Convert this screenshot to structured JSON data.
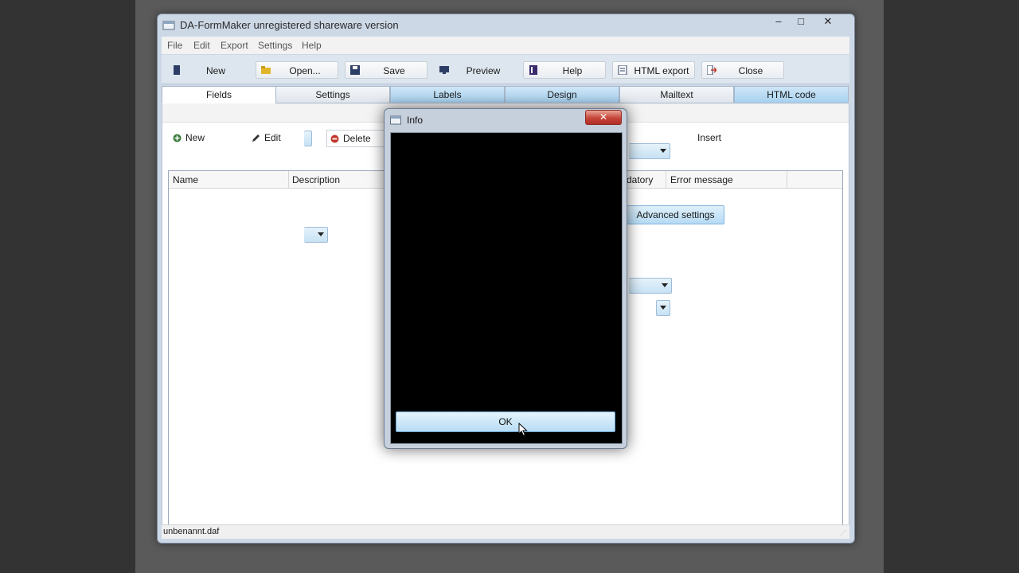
{
  "window": {
    "title": "DA-FormMaker unregistered shareware version",
    "minimize": "–",
    "maximize": "□",
    "close": "✕"
  },
  "menu": [
    "File",
    "Edit",
    "Export",
    "Settings",
    "Help"
  ],
  "toolbar": {
    "new": "New",
    "open": "Open...",
    "save": "Save",
    "preview": "Preview",
    "help": "Help",
    "html_export": "HTML export",
    "close": "Close"
  },
  "tabs": [
    "Fields",
    "Settings",
    "Labels",
    "Design",
    "Mailtext",
    "HTML code"
  ],
  "fields_panel": {
    "new": "New",
    "edit": "Edit",
    "delete": "Delete",
    "insert": "Insert",
    "columns": {
      "name": "Name",
      "description": "Description",
      "mandatory": "datory",
      "error_message": "Error message"
    },
    "advanced_settings": "Advanced settings"
  },
  "status": {
    "file": "unbenannt.daf"
  },
  "dialog": {
    "title": "Info",
    "close": "✕",
    "ok": "OK"
  },
  "colors": {
    "accent_blue": "#a7d1ef",
    "dialog_close": "#c6453a",
    "dialog_body": "#000000"
  }
}
